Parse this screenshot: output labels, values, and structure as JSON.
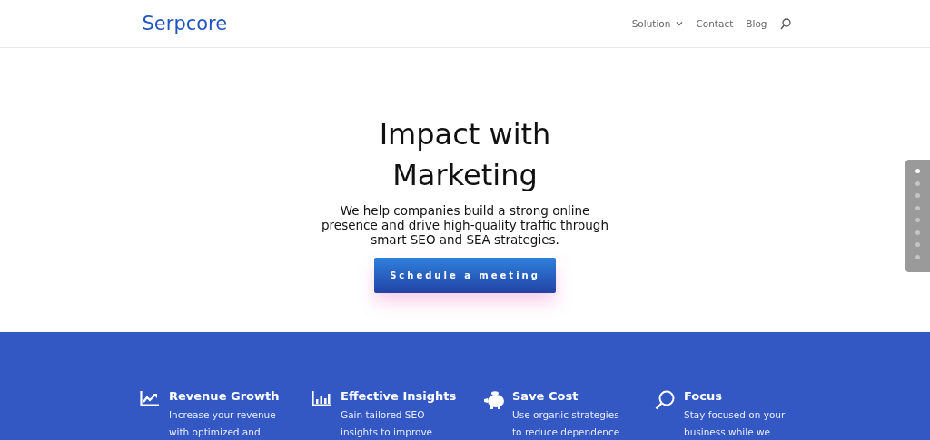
{
  "header": {
    "logo": "Serpcore",
    "nav": [
      {
        "label": "Solution",
        "dropdown": true
      },
      {
        "label": "Contact",
        "dropdown": false
      },
      {
        "label": "Blog",
        "dropdown": false
      }
    ]
  },
  "hero": {
    "title_lines": [
      "Impact with",
      "Marketing"
    ],
    "text_lines": [
      "We help companies build a strong online",
      "presence and drive high-quality traffic through",
      "smart SEO and SEA strategies."
    ],
    "button": "Schedule a meeting"
  },
  "section_dots": [
    {
      "selected": true
    },
    {
      "selected": false
    },
    {
      "selected": false
    },
    {
      "selected": false
    },
    {
      "selected": false
    },
    {
      "selected": false
    },
    {
      "selected": false
    },
    {
      "selected": false
    }
  ],
  "features": [
    {
      "kind": "chart",
      "title": "Revenue Growth",
      "text_lines": [
        "Increase your revenue",
        "with optimized and"
      ]
    },
    {
      "kind": "bars",
      "title": "Effective Insights",
      "text_lines": [
        "Gain tailored SEO",
        "insights to improve"
      ]
    },
    {
      "kind": "piggy",
      "title": "Save Cost",
      "text_lines": [
        "Use organic strategies",
        "to reduce dependence"
      ]
    },
    {
      "kind": "search",
      "title": "Focus",
      "text_lines": [
        "Stay focused on your",
        "business while we"
      ]
    }
  ]
}
